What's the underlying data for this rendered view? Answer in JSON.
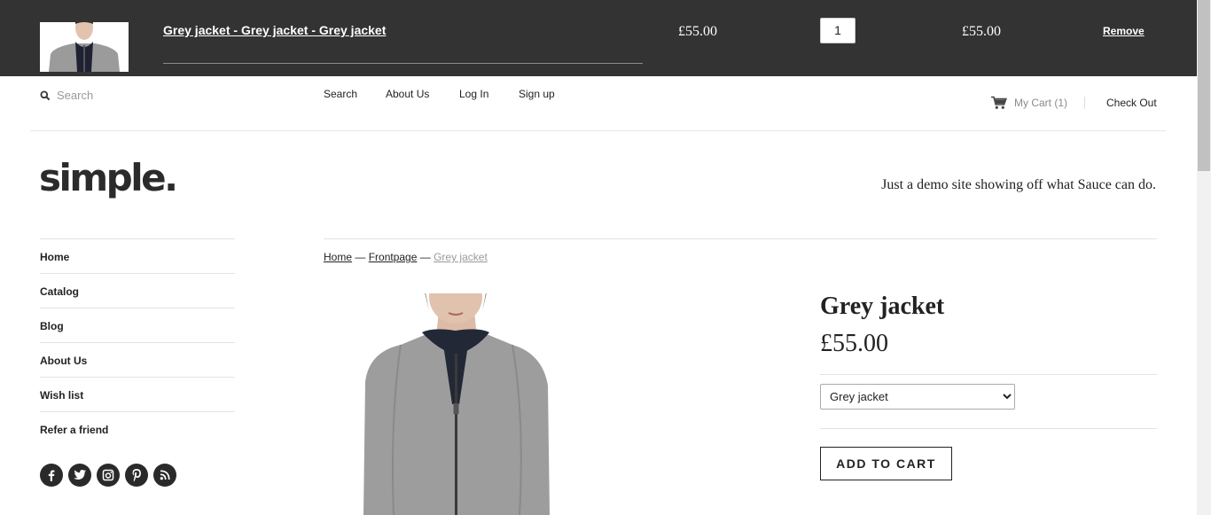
{
  "cart_bar": {
    "item_name": "Grey jacket - Grey jacket - Grey jacket",
    "price": "£55.00",
    "quantity": "1",
    "line_total": "£55.00",
    "remove_label": "Remove",
    "background_color": "#333333"
  },
  "utility_nav": {
    "search_placeholder": "Search",
    "links": [
      "Search",
      "About Us",
      "Log In",
      "Sign up"
    ],
    "cart_label": "My Cart (1)",
    "checkout_label": "Check Out"
  },
  "header": {
    "logo": "simple.",
    "tagline": "Just a demo site showing off what Sauce can do."
  },
  "sidebar": {
    "items": [
      "Home",
      "Catalog",
      "Blog",
      "About Us",
      "Wish list",
      "Refer a friend"
    ],
    "social_icons": [
      "facebook-icon",
      "twitter-icon",
      "instagram-icon",
      "pinterest-icon",
      "rss-icon"
    ]
  },
  "breadcrumb": {
    "home": "Home",
    "separator": "—",
    "frontpage": "Frontpage",
    "current": "Grey jacket"
  },
  "product": {
    "title": "Grey jacket",
    "price": "£55.00",
    "variant_selected": "Grey jacket",
    "add_to_cart_label": "ADD TO CART"
  }
}
